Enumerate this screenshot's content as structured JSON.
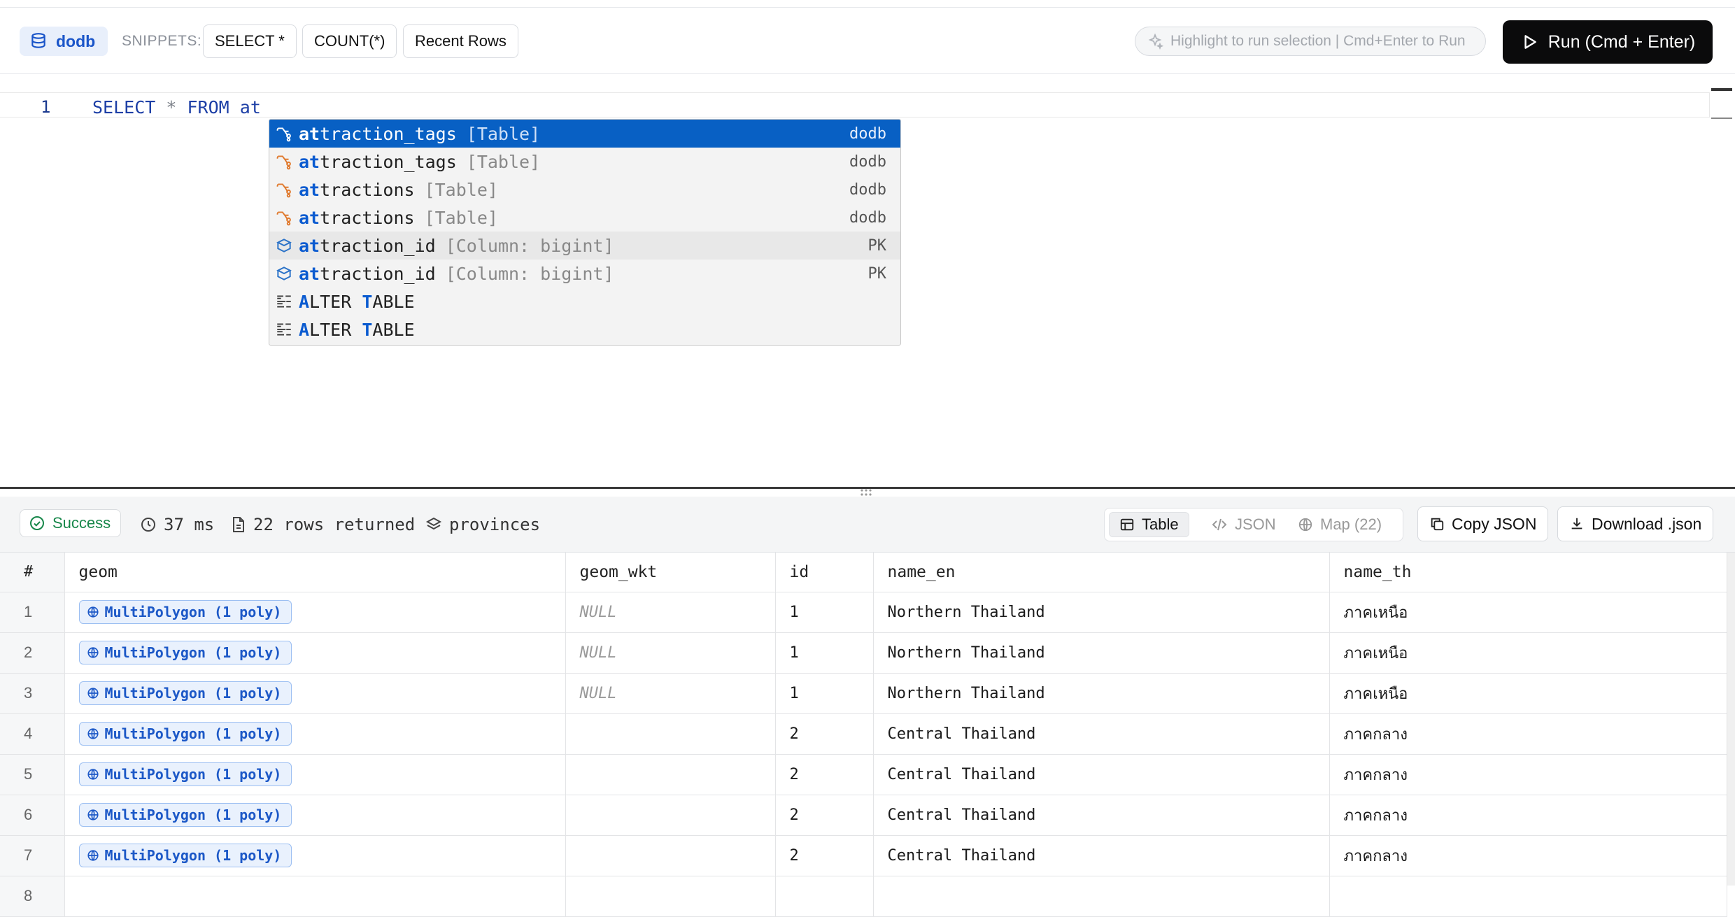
{
  "toolbar": {
    "db_name": "dodb",
    "snippets_label": "SNIPPETS:",
    "snippets": [
      "SELECT *",
      "COUNT(*)",
      "Recent Rows"
    ],
    "hint": "Highlight to run selection | Cmd+Enter to Run",
    "run_label": "Run (Cmd + Enter)"
  },
  "editor": {
    "line_number": "1",
    "code_keyword1": "SELECT",
    "code_star": "*",
    "code_keyword2": "FROM",
    "code_text": "at"
  },
  "autocomplete": [
    {
      "match": "at",
      "rest": "traction_tags",
      "kind": "[Table]",
      "source": "dodb",
      "icon": "table-icon"
    },
    {
      "match": "at",
      "rest": "traction_tags",
      "kind": "[Table]",
      "source": "dodb",
      "icon": "table-icon"
    },
    {
      "match": "at",
      "rest": "tractions",
      "kind": "[Table]",
      "source": "dodb",
      "icon": "table-icon"
    },
    {
      "match": "at",
      "rest": "tractions",
      "kind": "[Table]",
      "source": "dodb",
      "icon": "table-icon"
    },
    {
      "match": "at",
      "rest": "traction_id",
      "kind": "[Column: bigint]",
      "source": "PK",
      "icon": "column-icon"
    },
    {
      "match": "at",
      "rest": "traction_id",
      "kind": "[Column: bigint]",
      "source": "PK",
      "icon": "column-icon"
    },
    {
      "match": "A",
      "rest": "LTER ",
      "match2": "T",
      "rest2": "ABLE",
      "kind": "",
      "source": "",
      "icon": "keyword-icon"
    },
    {
      "match": "A",
      "rest": "LTER ",
      "match2": "T",
      "rest2": "ABLE",
      "kind": "",
      "source": "",
      "icon": "keyword-icon"
    }
  ],
  "results": {
    "status": "Success",
    "duration": "37 ms",
    "rows_returned": "22 rows returned",
    "table_name": "provinces",
    "views": [
      "Table",
      "JSON",
      "Map (22)"
    ],
    "copy_label": "Copy JSON",
    "download_label": "Download .json"
  },
  "grid": {
    "columns": [
      "#",
      "geom",
      "geom_wkt",
      "id",
      "name_en",
      "name_th"
    ],
    "rows": [
      {
        "n": "1",
        "geom": "MultiPolygon (1 poly)",
        "geom_wkt": "NULL",
        "id": "1",
        "name_en": "Northern Thailand",
        "name_th": "ภาคเหนือ"
      },
      {
        "n": "2",
        "geom": "MultiPolygon (1 poly)",
        "geom_wkt": "NULL",
        "id": "1",
        "name_en": "Northern Thailand",
        "name_th": "ภาคเหนือ"
      },
      {
        "n": "3",
        "geom": "MultiPolygon (1 poly)",
        "geom_wkt": "NULL",
        "id": "1",
        "name_en": "Northern Thailand",
        "name_th": "ภาคเหนือ"
      },
      {
        "n": "4",
        "geom": "MultiPolygon (1 poly)",
        "geom_wkt": "",
        "id": "2",
        "name_en": "Central Thailand",
        "name_th": "ภาคกลาง"
      },
      {
        "n": "5",
        "geom": "MultiPolygon (1 poly)",
        "geom_wkt": "",
        "id": "2",
        "name_en": "Central Thailand",
        "name_th": "ภาคกลาง"
      },
      {
        "n": "6",
        "geom": "MultiPolygon (1 poly)",
        "geom_wkt": "",
        "id": "2",
        "name_en": "Central Thailand",
        "name_th": "ภาคกลาง"
      },
      {
        "n": "7",
        "geom": "MultiPolygon (1 poly)",
        "geom_wkt": "",
        "id": "2",
        "name_en": "Central Thailand",
        "name_th": "ภาคกลาง"
      },
      {
        "n": "8",
        "geom": "",
        "geom_wkt": "",
        "id": "",
        "name_en": "",
        "name_th": ""
      }
    ]
  },
  "colors": {
    "accent_blue": "#0860c4",
    "success_green": "#17874a",
    "run_button": "#0b0b0c",
    "table_icon": "#e07a2e"
  }
}
